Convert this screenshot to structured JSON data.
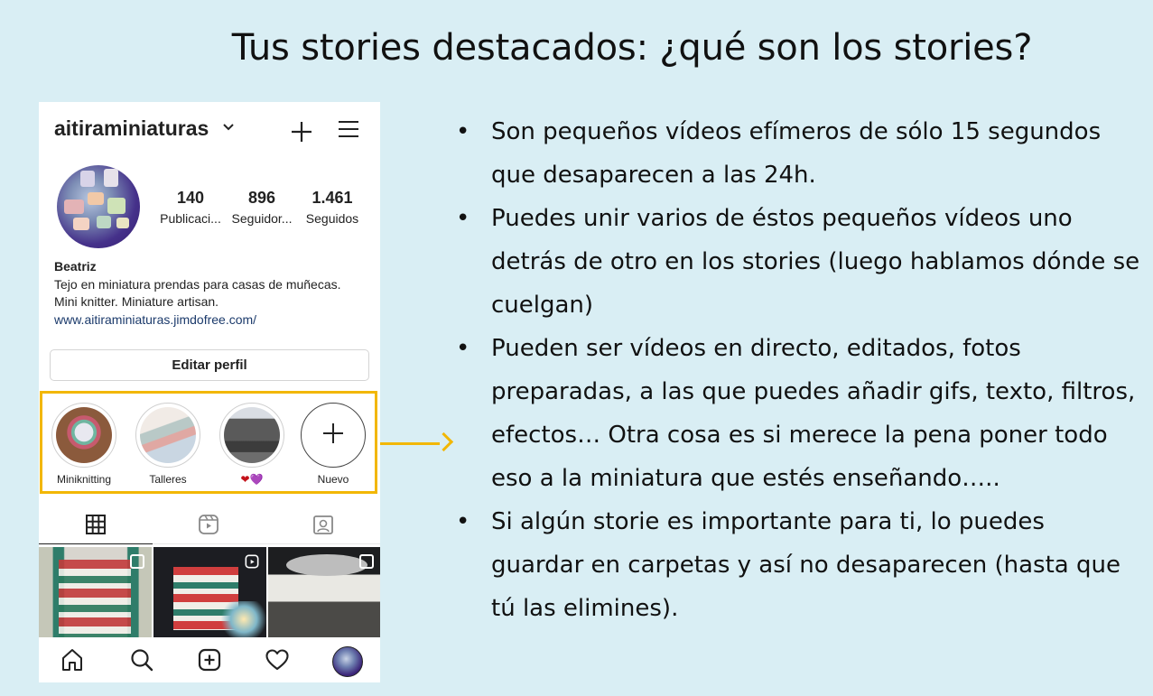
{
  "slide": {
    "title": "Tus stories destacados: ¿qué son los stories?"
  },
  "profile": {
    "username": "aitiraminiaturas",
    "stats": [
      {
        "value": "140",
        "label": "Publicaci..."
      },
      {
        "value": "896",
        "label": "Seguidor..."
      },
      {
        "value": "1.461",
        "label": "Seguidos"
      }
    ],
    "bio_name": "Beatriz",
    "bio_line1": "Tejo en miniatura prendas para casas de muñecas.",
    "bio_line2": "Mini knitter. Miniature artisan.",
    "bio_link": "www.aitiraminiaturas.jimdofree.com/",
    "edit_button": "Editar perfil",
    "highlights": [
      {
        "label": "Miniknitting"
      },
      {
        "label": "Talleres"
      },
      {
        "label": "❤💜"
      },
      {
        "label": "Nuevo"
      }
    ]
  },
  "icons": {
    "header_new_post": "plus-icon",
    "header_menu": "hamburger-menu-icon",
    "username_dropdown": "chevron-down-icon",
    "tab_grid": "grid-icon",
    "tab_reels": "reels-icon",
    "tab_tagged": "tagged-user-icon",
    "nav_home": "home-icon",
    "nav_search": "search-icon",
    "nav_create": "add-post-icon",
    "nav_activity": "heart-icon",
    "nav_profile": "profile-avatar"
  },
  "colors": {
    "slide_background": "#d9eef4",
    "highlight_accent": "#f2b705",
    "link": "#1b3a6b"
  },
  "bullets": [
    "Son pequeños vídeos efímeros de sólo 15 segundos que desaparecen a las 24h.",
    "Puedes unir varios de éstos pequeños vídeos uno detrás de otro en los stories (luego hablamos dónde se cuelgan)",
    "Pueden ser vídeos en directo, editados, fotos preparadas, a las que puedes añadir gifs, texto, filtros, efectos… Otra cosa es si merece la pena poner todo eso a la miniatura que estés enseñando…..",
    "Si algún storie es importante para ti, lo puedes guardar en carpetas y así no desaparecen (hasta que tú las elimines)."
  ]
}
